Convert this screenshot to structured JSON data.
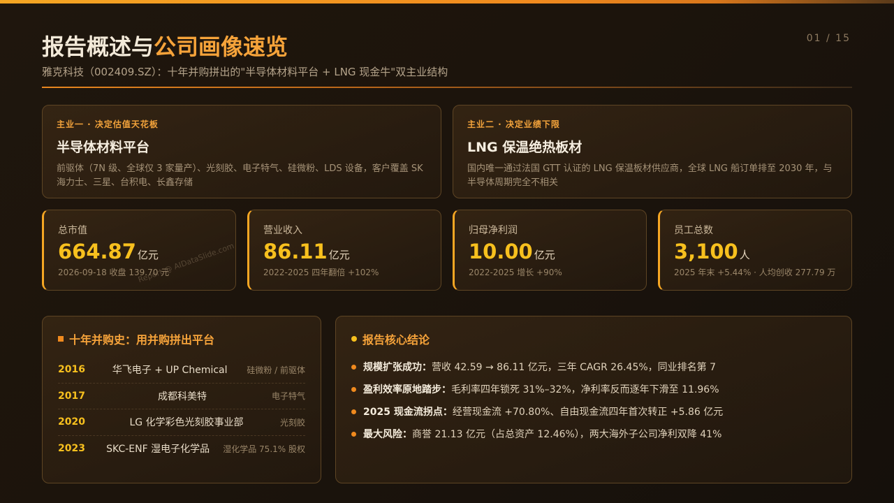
{
  "header": {
    "title_part1": "报告概述与",
    "title_highlight": "公司画像速览",
    "subtitle": "雅克科技（002409.SZ）：十年并购拼出的\"半导体材料平台 + LNG 现金牛\"双主业结构",
    "page_number": "01 / 15"
  },
  "businesses": [
    {
      "tag": "主业一 · 决定估值天花板",
      "name": "半导体材料平台",
      "desc": "前驱体（7N 级、全球仅 3 家量产）、光刻胶、电子特气、硅微粉、LDS 设备，客户覆盖 SK 海力士、三星、台积电、长鑫存储"
    },
    {
      "tag": "主业二 · 决定业绩下限",
      "name": "LNG 保温绝热板材",
      "desc": "国内唯一通过法国 GTT 认证的 LNG 保温板材供应商，全球 LNG 船订单排至 2030 年，与半导体周期完全不相关"
    }
  ],
  "kpis": [
    {
      "label": "总市值",
      "value": "664.87",
      "unit": "亿元",
      "note": "2026-09-18 收盘 139.70 元"
    },
    {
      "label": "营业收入",
      "value": "86.11",
      "unit": "亿元",
      "note": "2022-2025 四年翻倍 +102%"
    },
    {
      "label": "归母净利润",
      "value": "10.00",
      "unit": "亿元",
      "note": "2022-2025 增长 +90%"
    },
    {
      "label": "员工总数",
      "value": "3,100",
      "unit": "人",
      "note": "2025 年末 +5.44% · 人均创收 277.79 万"
    }
  ],
  "watermark": "Report @ AIDataSlide.com",
  "history": {
    "title": "十年并购史：用并购拼出平台",
    "rows": [
      {
        "year": "2016",
        "company": "华飞电子 + UP Chemical",
        "type": "硅微粉 / 前驱体"
      },
      {
        "year": "2017",
        "company": "成都科美特",
        "type": "电子特气"
      },
      {
        "year": "2020",
        "company": "LG 化学彩色光刻胶事业部",
        "type": "光刻胶"
      },
      {
        "year": "2023",
        "company": "SKC-ENF 湿电子化学品",
        "type": "湿化学品 75.1% 股权"
      }
    ]
  },
  "conclusions": {
    "title": "报告核心结论",
    "items": [
      {
        "key": "规模扩张成功：",
        "text": "营收 42.59 → 86.11 亿元，三年 CAGR 26.45%，同业排名第 7"
      },
      {
        "key": "盈利效率原地踏步：",
        "text": "毛利率四年锁死 31%–32%，净利率反而逐年下滑至 11.96%"
      },
      {
        "key": "2025 现金流拐点：",
        "text": "经营现金流 +70.80%、自由现金流四年首次转正 +5.86 亿元"
      },
      {
        "key": "最大风险：",
        "text": "商誉 21.13 亿元（占总资产 12.46%），两大海外子公司净利双降 41%"
      }
    ]
  },
  "colors": {
    "accent": "#f5a623",
    "value": "#f7c01e",
    "background": "#1c140c"
  }
}
